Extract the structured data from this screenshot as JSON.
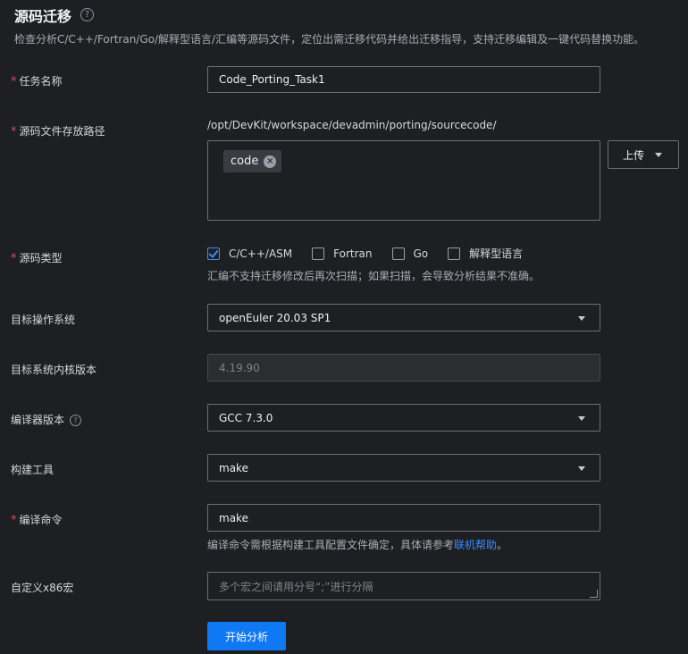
{
  "header": {
    "title": "源码迁移",
    "help_icon": "?",
    "description": "检查分析C/C++/Fortran/Go/解释型语言/汇编等源码文件，定位出需迁移代码并给出迁移指导，支持迁移编辑及一键代码替换功能。"
  },
  "form": {
    "required_mark": "*",
    "task_name": {
      "label": "任务名称",
      "value": "Code_Porting_Task1"
    },
    "source_path": {
      "label": "源码文件存放路径",
      "base_path": "/opt/DevKit/workspace/devadmin/porting/sourcecode/",
      "tags": [
        "code"
      ],
      "tag_close_icon": "×",
      "upload_label": "上传"
    },
    "source_type": {
      "label": "源码类型",
      "options": [
        {
          "label": "C/C++/ASM",
          "checked": true
        },
        {
          "label": "Fortran",
          "checked": false
        },
        {
          "label": "Go",
          "checked": false
        },
        {
          "label": "解释型语言",
          "checked": false
        }
      ],
      "hint": "汇编不支持迁移修改后再次扫描；如果扫描，会导致分析结果不准确。"
    },
    "target_os": {
      "label": "目标操作系统",
      "value": "openEuler 20.03 SP1"
    },
    "kernel_version": {
      "label": "目标系统内核版本",
      "value": "4.19.90"
    },
    "compiler_version": {
      "label": "编译器版本",
      "help_icon": "?",
      "value": "GCC 7.3.0"
    },
    "build_tool": {
      "label": "构建工具",
      "value": "make"
    },
    "compile_command": {
      "label": "编译命令",
      "value": "make",
      "hint_prefix": "编译命令需根据构建工具配置文件确定，具体请参考",
      "hint_link": "联机帮助",
      "hint_suffix": "。"
    },
    "custom_macro": {
      "label": "自定义x86宏",
      "placeholder": "多个宏之间请用分号“;”进行分隔"
    },
    "submit_label": "开始分析"
  },
  "colors": {
    "background": "#1e1f22",
    "primary": "#0f78f2",
    "link": "#3c8cff",
    "required": "#e5484d"
  }
}
